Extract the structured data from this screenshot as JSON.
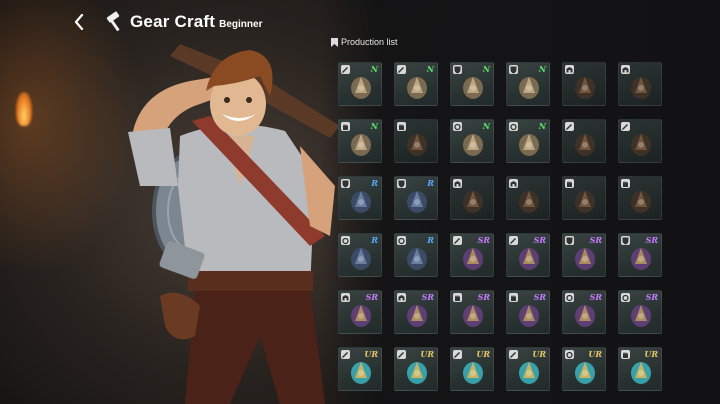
{
  "header": {
    "title": "Gear Craft",
    "subtitle": "Beginner"
  },
  "production": {
    "label": "Production list"
  },
  "colors": {
    "N": "#5fdc6a",
    "R": "#5aa8ff",
    "SR": "#c77bff",
    "UR": "#eac56a"
  },
  "grid": {
    "rows": [
      [
        {
          "rank": "N",
          "icon": "sword-icon",
          "badge": "pencil"
        },
        {
          "rank": "N",
          "icon": "leather-whip-icon",
          "badge": "pencil"
        },
        {
          "rank": "N",
          "icon": "chest-armor-icon",
          "badge": "shield"
        },
        {
          "rank": "N",
          "icon": "cloth-robe-icon",
          "badge": "shield"
        },
        {
          "rank": "",
          "icon": "dark-helmet-icon",
          "badge": "helmet"
        },
        {
          "rank": "",
          "icon": "belt-icon",
          "badge": "helmet"
        }
      ],
      [
        {
          "rank": "N",
          "icon": "gauntlet-icon",
          "badge": "hand"
        },
        {
          "rank": "",
          "icon": "bracer-icon",
          "badge": "hand"
        },
        {
          "rank": "N",
          "icon": "ring-icon",
          "badge": "ring"
        },
        {
          "rank": "N",
          "icon": "necklace-icon",
          "badge": "ring"
        },
        {
          "rank": "",
          "icon": "dagger-icon",
          "badge": "pencil"
        },
        {
          "rank": "",
          "icon": "spear-icon",
          "badge": "pencil"
        }
      ],
      [
        {
          "rank": "R",
          "icon": "breastplate-icon",
          "badge": "shield"
        },
        {
          "rank": "R",
          "icon": "hooded-cloak-icon",
          "badge": "shield"
        },
        {
          "rank": "",
          "icon": "iron-helmet-icon",
          "badge": "helmet"
        },
        {
          "rank": "",
          "icon": "cap-icon",
          "badge": "helmet"
        },
        {
          "rank": "",
          "icon": "glove-icon",
          "badge": "hand"
        },
        {
          "rank": "",
          "icon": "vambrace-icon",
          "badge": "hand"
        }
      ],
      [
        {
          "rank": "R",
          "icon": "pendant-icon",
          "badge": "ring"
        },
        {
          "rank": "R",
          "icon": "charm-icon",
          "badge": "ring"
        },
        {
          "rank": "SR",
          "icon": "golden-sword-icon",
          "badge": "pencil"
        },
        {
          "rank": "SR",
          "icon": "golden-staff-icon",
          "badge": "pencil"
        },
        {
          "rank": "SR",
          "icon": "plate-armor-icon",
          "badge": "shield"
        },
        {
          "rank": "SR",
          "icon": "knight-armor-icon",
          "badge": "shield"
        }
      ],
      [
        {
          "rank": "SR",
          "icon": "great-helm-icon",
          "badge": "helmet"
        },
        {
          "rank": "SR",
          "icon": "crown-icon",
          "badge": "helmet"
        },
        {
          "rank": "SR",
          "icon": "plate-gauntlet-icon",
          "badge": "hand"
        },
        {
          "rank": "SR",
          "icon": "jeweled-bracer-icon",
          "badge": "hand"
        },
        {
          "rank": "SR",
          "icon": "ruby-amulet-icon",
          "badge": "ring"
        },
        {
          "rank": "SR",
          "icon": "jeweled-ring-icon",
          "badge": "ring"
        }
      ],
      [
        {
          "rank": "UR",
          "icon": "crystal-sword-icon",
          "badge": "pencil"
        },
        {
          "rank": "UR",
          "icon": "azure-axe-icon",
          "badge": "pencil"
        },
        {
          "rank": "UR",
          "icon": "jade-blade-icon",
          "badge": "pencil"
        },
        {
          "rank": "UR",
          "icon": "crescent-scythe-icon",
          "badge": "pencil"
        },
        {
          "rank": "UR",
          "icon": "ornate-bracelet-icon",
          "badge": "ring"
        },
        {
          "rank": "UR",
          "icon": "golden-gauntlet-icon",
          "badge": "hand"
        }
      ]
    ]
  }
}
